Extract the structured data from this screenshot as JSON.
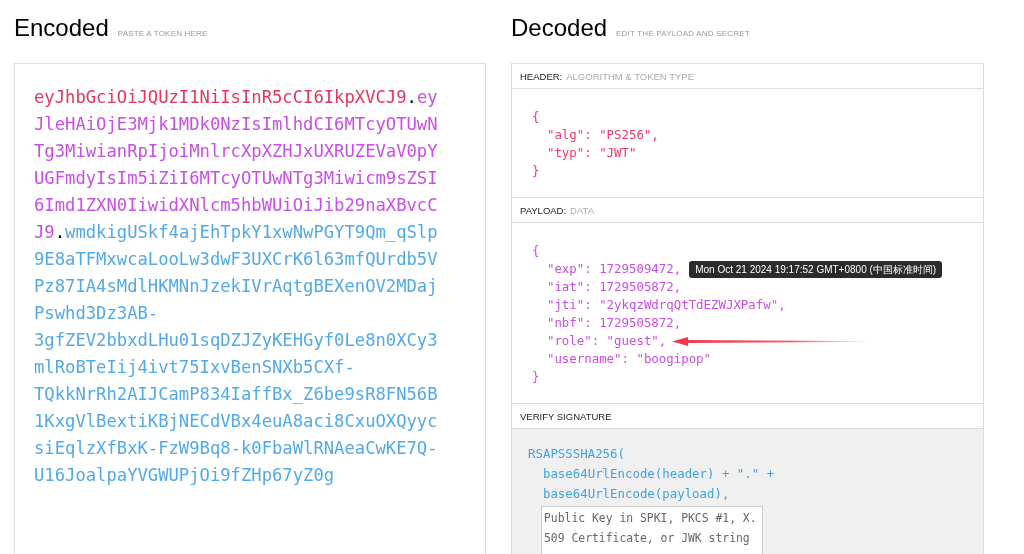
{
  "encoded": {
    "title": "Encoded",
    "subtitle": "PASTE A TOKEN HERE",
    "lines": [
      [
        {
          "kind": "header",
          "text": "eyJhbGciOiJQUzI1NiIsInR5cCI6IkpXVCJ9"
        },
        {
          "kind": "dot",
          "text": "."
        },
        {
          "kind": "payload",
          "text": "ey"
        }
      ],
      [
        {
          "kind": "payload",
          "text": "JleHAiOjE3Mjk1MDk0NzIsImlhdCI6MTcyOTUwN"
        }
      ],
      [
        {
          "kind": "payload",
          "text": "Tg3MiwianRpIjoiMnlrcXpXZHJxUXRUZEVaV0pY"
        }
      ],
      [
        {
          "kind": "payload",
          "text": "UGFmdyIsIm5iZiI6MTcyOTUwNTg3Miwicm9sZSI"
        }
      ],
      [
        {
          "kind": "payload",
          "text": "6Imd1ZXN0IiwidXNlcm5hbWUiOiJib29naXBvcC"
        }
      ],
      [
        {
          "kind": "payload",
          "text": "J9"
        },
        {
          "kind": "dot",
          "text": "."
        },
        {
          "kind": "signature",
          "text": "wmdkigUSkf4ajEhTpkY1xwNwPGYT9Qm_qSlp"
        }
      ],
      [
        {
          "kind": "signature",
          "text": "9E8aTFMxwcaLooLw3dwF3UXCrK6l63mfQUrdb5V"
        }
      ],
      [
        {
          "kind": "signature",
          "text": "Pz87IA4sMdlHKMNnJzekIVrAqtgBEXenOV2MDaj"
        }
      ],
      [
        {
          "kind": "signature",
          "text": "Pswhd3Dz3AB-"
        }
      ],
      [
        {
          "kind": "signature",
          "text": "3gfZEV2bbxdLHu01sqDZJZyKEHGyf0Le8n0XCy3"
        }
      ],
      [
        {
          "kind": "signature",
          "text": "mlRoBTeIij4ivt75IxvBenSNXb5CXf-"
        }
      ],
      [
        {
          "kind": "signature",
          "text": "TQkkNrRh2AIJCamP834IaffBx_Z6be9sR8FN56B"
        }
      ],
      [
        {
          "kind": "signature",
          "text": "1KxgVlBextiKBjNECdVBx4euA8aci8CxuOXQyyc"
        }
      ],
      [
        {
          "kind": "signature",
          "text": "siEqlzXfBxK-FzW9Bq8-k0FbaWlRNAeaCwKE7Q-"
        }
      ],
      [
        {
          "kind": "signature",
          "text": "U16JoalpaYVGWUPjOi9fZHp67yZ0g"
        }
      ]
    ]
  },
  "decoded": {
    "title": "Decoded",
    "subtitle": "EDIT THE PAYLOAD AND SECRET",
    "sections": [
      {
        "kind": "header",
        "label": "HEADER:",
        "sublabel": "ALGORITHM & TOKEN TYPE",
        "lines": [
          {
            "text": "{"
          },
          {
            "text": "  \"alg\": \"PS256\","
          },
          {
            "text": "  \"typ\": \"JWT\""
          },
          {
            "text": "}"
          }
        ]
      },
      {
        "kind": "payload",
        "label": "PAYLOAD:",
        "sublabel": "DATA",
        "lines": [
          {
            "text": "{",
            "arrow": false
          },
          {
            "text": "  \"exp\": 1729509472,",
            "arrow": false,
            "tooltip": "Mon Oct 21 2024 19:17:52 GMT+0800 (中国标准时间)"
          },
          {
            "text": "  \"iat\": 1729505872,",
            "arrow": false
          },
          {
            "text": "  \"jti\": \"2ykqzWdrqQtTdEZWJXPafw\",",
            "arrow": false
          },
          {
            "text": "  \"nbf\": 1729505872,",
            "arrow": false
          },
          {
            "text": "  \"role\": \"guest\",",
            "arrow": true
          },
          {
            "text": "  \"username\": \"boogipop\"",
            "arrow": false
          },
          {
            "text": "}",
            "arrow": false
          }
        ]
      },
      {
        "kind": "signature",
        "label": "VERIFY SIGNATURE",
        "lines": [
          {
            "text": "RSAPSSSHA256("
          },
          {
            "text": "  base64UrlEncode(header) + \".\" +"
          },
          {
            "text": "  base64UrlEncode(payload),"
          }
        ],
        "key_field": {
          "placeholder": "Public Key in SPKI, PKCS #1, X.509 Certificate, or JWK string"
        }
      }
    ]
  }
}
